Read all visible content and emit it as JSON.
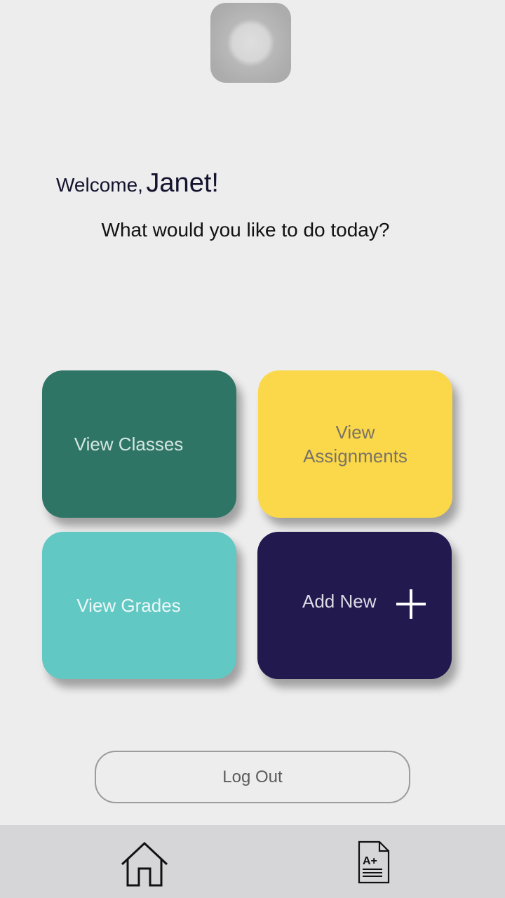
{
  "profile": {
    "avatar_icon": "avatar-placeholder-icon"
  },
  "greeting": {
    "welcome": "Welcome,",
    "name": "Janet!",
    "prompt": "What would you like to do today?"
  },
  "tiles": [
    {
      "label": "View Classes",
      "color": "#2f7566"
    },
    {
      "label": "View Assignments",
      "label_line1": "View",
      "label_line2": "Assignments",
      "color": "#fbd849"
    },
    {
      "label": "View Grades",
      "color": "#61c8c3"
    },
    {
      "label": "Add New",
      "icon": "plus-icon",
      "color": "#22194f"
    }
  ],
  "logout": {
    "label": "Log Out"
  },
  "navbar": {
    "items": [
      {
        "icon": "home-icon"
      },
      {
        "icon": "grade-document-icon",
        "glyph": "A+"
      }
    ]
  }
}
